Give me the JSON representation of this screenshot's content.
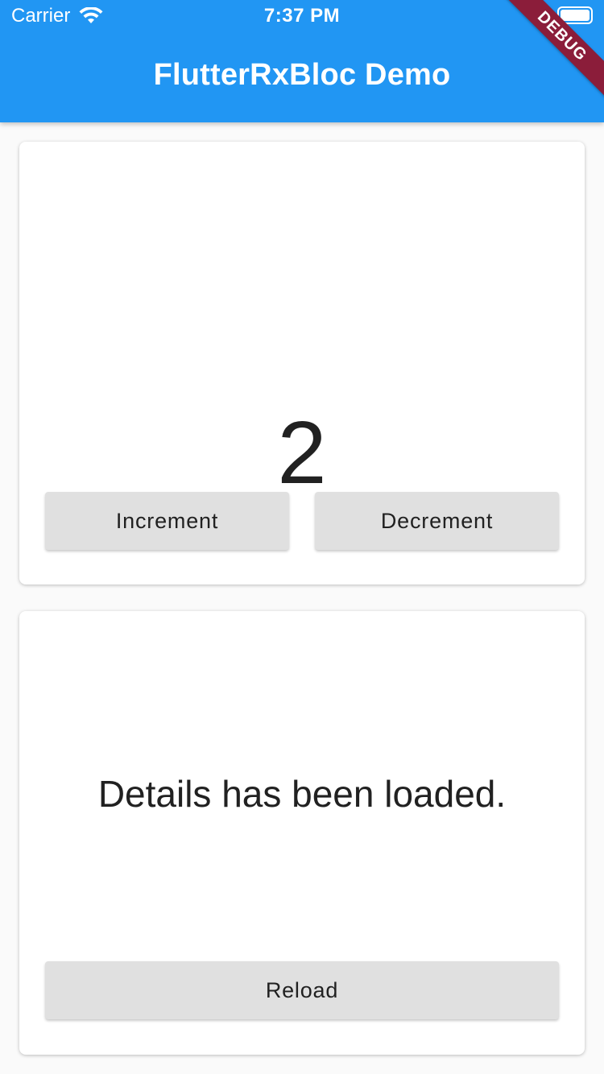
{
  "status_bar": {
    "carrier": "Carrier",
    "time": "7:37 PM"
  },
  "app_bar": {
    "title": "FlutterRxBloc Demo",
    "debug_banner": "DEBUG"
  },
  "counter_card": {
    "value": "2",
    "increment_label": "Increment",
    "decrement_label": "Decrement"
  },
  "details_card": {
    "message": "Details has been loaded.",
    "reload_label": "Reload"
  },
  "colors": {
    "app_bar": "#2196f3",
    "debug_banner": "#8b1d3a",
    "button": "#e0e0e0",
    "background": "#fafafa"
  }
}
